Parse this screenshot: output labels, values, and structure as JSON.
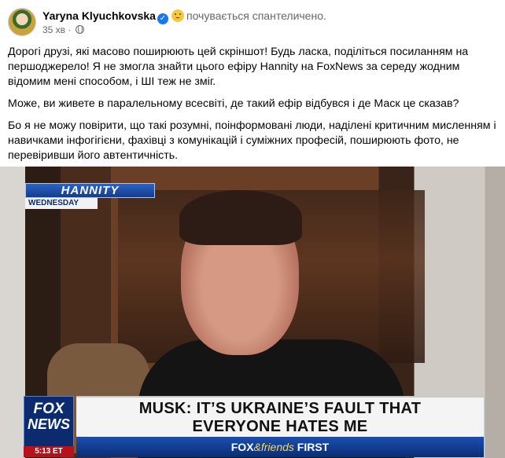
{
  "author": {
    "name": "Yaryna Klyuchkovska",
    "feeling": "почувається спантеличено.",
    "timestamp": "35 хв",
    "privacy_icon": "globe-icon"
  },
  "post": {
    "paragraphs": [
      "Дорогі друзі, які масово поширюють цей скріншот! Будь ласка, поділіться посиланням на першоджерело! Я не змогла знайти цього ефіру Hannity на FoxNews за середу жодним відомим мені способом, і ШІ теж не зміг.",
      "Може, ви живете в паралельному всесвіті, де такий ефір відбувся і де Маск це сказав?",
      "Бо я не можу повірити, що такі розумні, поінформовані люди, наділені критичним мисленням і навичками інфогігієни, фахівці з комунікацій і суміжних професій, поширюють фото, не перевіривши його автентичність."
    ]
  },
  "image": {
    "show_title": "HANNITY",
    "show_day": "WEDNESDAY",
    "logo_line1": "FOX",
    "logo_line2": "NEWS",
    "logo_time": "5:13 ET",
    "headline_line1": "MUSK: IT’S UKRAINE’S FAULT THAT",
    "headline_line2": "EVERYONE HATES ME",
    "bar_fox": "FOX",
    "bar_amp": "&friends",
    "bar_first": "FIRST"
  },
  "colors": {
    "link_blue": "#1877f2",
    "secondary_text": "#65676b",
    "fox_navy": "#0c2b6e",
    "fox_red": "#b5121b"
  }
}
